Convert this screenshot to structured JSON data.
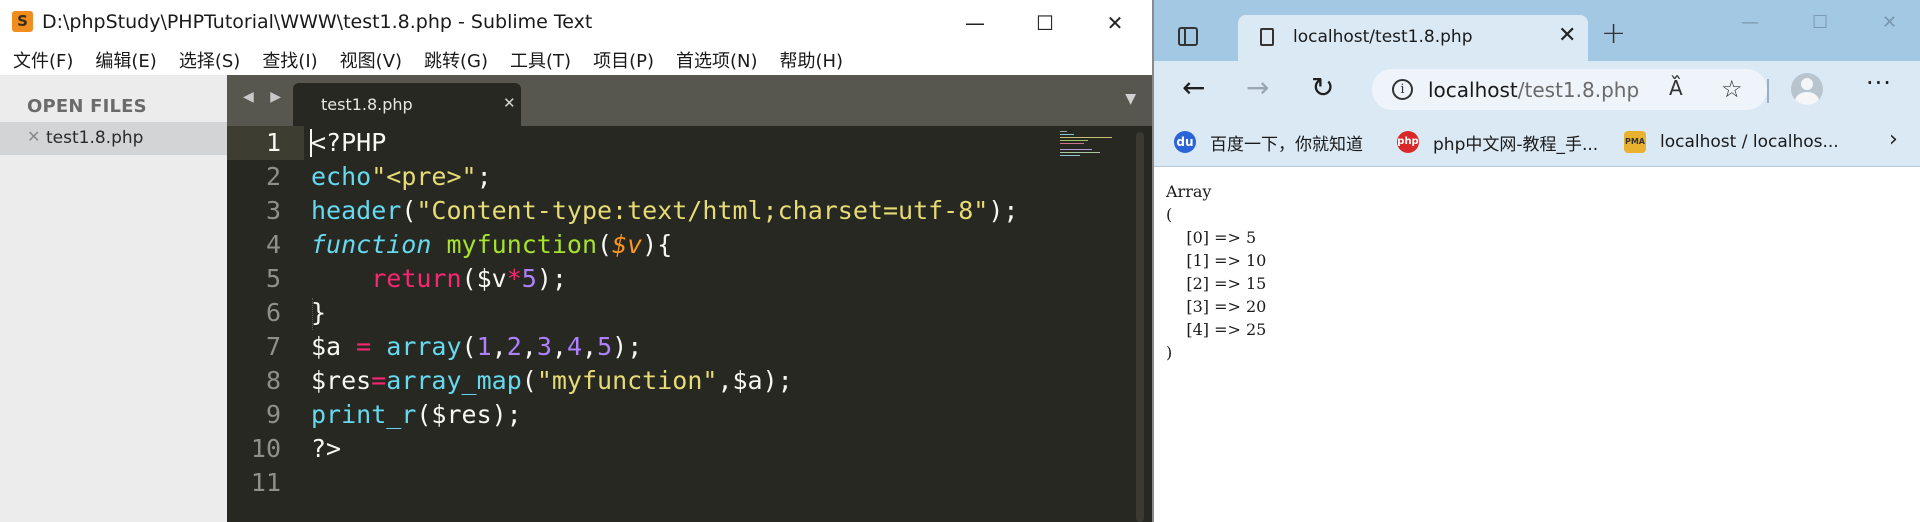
{
  "sublime": {
    "title": "D:\\phpStudy\\PHPTutorial\\WWW\\test1.8.php - Sublime Text",
    "logo_glyph": "S",
    "controls": {
      "minimize": "—",
      "maximize": "☐",
      "close": "✕"
    },
    "menu": [
      "文件(F)",
      "编辑(E)",
      "选择(S)",
      "查找(I)",
      "视图(V)",
      "跳转(G)",
      "工具(T)",
      "项目(P)",
      "首选项(N)",
      "帮助(H)"
    ],
    "sidebar": {
      "heading": "OPEN FILES",
      "file_close": "✕",
      "file": "test1.8.php"
    },
    "tabs": {
      "nav": "◀ ▶",
      "active_label": "test1.8.php",
      "close": "✕",
      "dropdown": "▼"
    },
    "line_numbers": [
      "1",
      "2",
      "3",
      "4",
      "5",
      "6",
      "7",
      "8",
      "9",
      "10",
      "11"
    ],
    "code": {
      "l1": "<?PHP",
      "l2_fn": "echo",
      "l2_str": "\"<pre>\"",
      "l2_end": ";",
      "l3_fn": "header",
      "l3_open": "(",
      "l3_str": "\"Content-type:text/html;charset=utf-8\"",
      "l3_end": ");",
      "l4_kw": "function",
      "l4_sp": " ",
      "l4_name": "myfunction",
      "l4_open": "(",
      "l4_param": "$v",
      "l4_end": "){",
      "l5_indent": "    ",
      "l5_kw": "return",
      "l5_open": "($v",
      "l5_op": "*",
      "l5_num": "5",
      "l5_end": ");",
      "l6": "}",
      "l7_var": "$a ",
      "l7_op": "=",
      "l7_sp": " ",
      "l7_fn": "array",
      "l7_open": "(",
      "l7_n1": "1",
      "l7_n2": "2",
      "l7_n3": "3",
      "l7_n4": "4",
      "l7_n5": "5",
      "l7_comma": ",",
      "l7_end": ");",
      "l8_var": "$res",
      "l8_op": "=",
      "l8_fn": "array_map",
      "l8_open": "(",
      "l8_str": "\"myfunction\"",
      "l8_end": ",$a);",
      "l9_fn": "print_r",
      "l9_end": "($res);",
      "l10": "?>"
    }
  },
  "browser": {
    "tab_title": "localhost/test1.8.php",
    "tab_close": "✕",
    "new_tab": "+",
    "controls": {
      "minimize": "—",
      "maximize": "☐",
      "close": "✕"
    },
    "nav": {
      "back": "←",
      "forward": "→",
      "refresh": "↻"
    },
    "info_glyph": "i",
    "url_host": "localhost",
    "url_path": "/test1.8.php",
    "read_aloud": "A᷈",
    "favorite_glyph": "☆",
    "more": "···",
    "favorites": [
      {
        "icon": "du",
        "label": "百度一下，你就知道"
      },
      {
        "icon": "php",
        "label": "php中文网-教程_手..."
      },
      {
        "icon": "PMA",
        "label": "localhost / localhos..."
      }
    ],
    "fav_chevron": "›",
    "page_output": "Array\n(\n    [0] => 5\n    [1] => 10\n    [2] => 15\n    [3] => 20\n    [4] => 25\n)"
  }
}
